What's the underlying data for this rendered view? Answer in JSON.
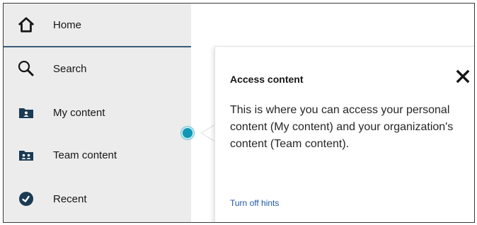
{
  "sidebar": {
    "items": [
      {
        "label": "Home",
        "icon": "home-icon"
      },
      {
        "label": "Search",
        "icon": "search-icon"
      },
      {
        "label": "My content",
        "icon": "my-content-icon"
      },
      {
        "label": "Team content",
        "icon": "team-content-icon"
      },
      {
        "label": "Recent",
        "icon": "recent-icon"
      }
    ]
  },
  "popover": {
    "title": "Access content",
    "body": "This is where you can access your personal content (My content) and your organization's content (Team content).",
    "link": "Turn off hints",
    "close_icon": "close-icon"
  },
  "colors": {
    "sidebar_bg": "#ececec",
    "active_underline": "#395b7a",
    "hint_dot": "#0f98b5",
    "link": "#1f57a8",
    "icon_dark": "#1b3a54"
  }
}
